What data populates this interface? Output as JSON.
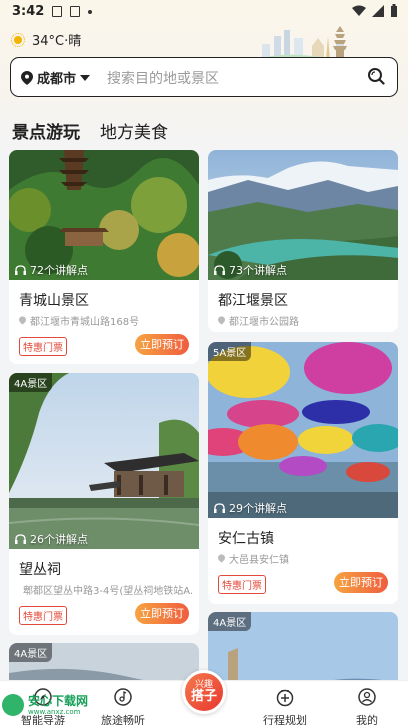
{
  "status_bar": {
    "time": "3:42"
  },
  "weather": {
    "text": "34°C·晴"
  },
  "search": {
    "city": "成都市",
    "placeholder": "搜索目的地或景区"
  },
  "tabs": [
    {
      "label": "景点游玩",
      "active": true
    },
    {
      "label": "地方美食",
      "active": false
    }
  ],
  "cards": [
    {
      "title": "青城山景区",
      "audio": "72个讲解点",
      "address": "都江堰市青城山路168号",
      "tag": "特惠门票",
      "button": "立即预订"
    },
    {
      "title": "都江堰景区",
      "audio": "73个讲解点",
      "address": "都江堰市公园路"
    },
    {
      "title": "望丛祠",
      "badge": "4A景区",
      "audio": "26个讲解点",
      "address": "郫都区望丛中路3-4号(望丛祠地铁站A...",
      "tag": "特惠门票",
      "button": "立即预订"
    },
    {
      "title": "安仁古镇",
      "badge": "5A景区",
      "audio": "29个讲解点",
      "address": "大邑县安仁镇",
      "tag": "特惠门票",
      "button": "立即预订"
    },
    {
      "badge": "4A景区"
    },
    {
      "badge": "4A景区"
    }
  ],
  "nav": [
    {
      "label": "智能导游"
    },
    {
      "label": "旅途畅听"
    },
    {
      "label": "行程规划"
    },
    {
      "label": "我的"
    }
  ],
  "fab": {
    "line1": "兴趣",
    "line2": "搭子"
  },
  "watermark": {
    "title": "安心下载网",
    "sub": "www.anxz.com"
  }
}
